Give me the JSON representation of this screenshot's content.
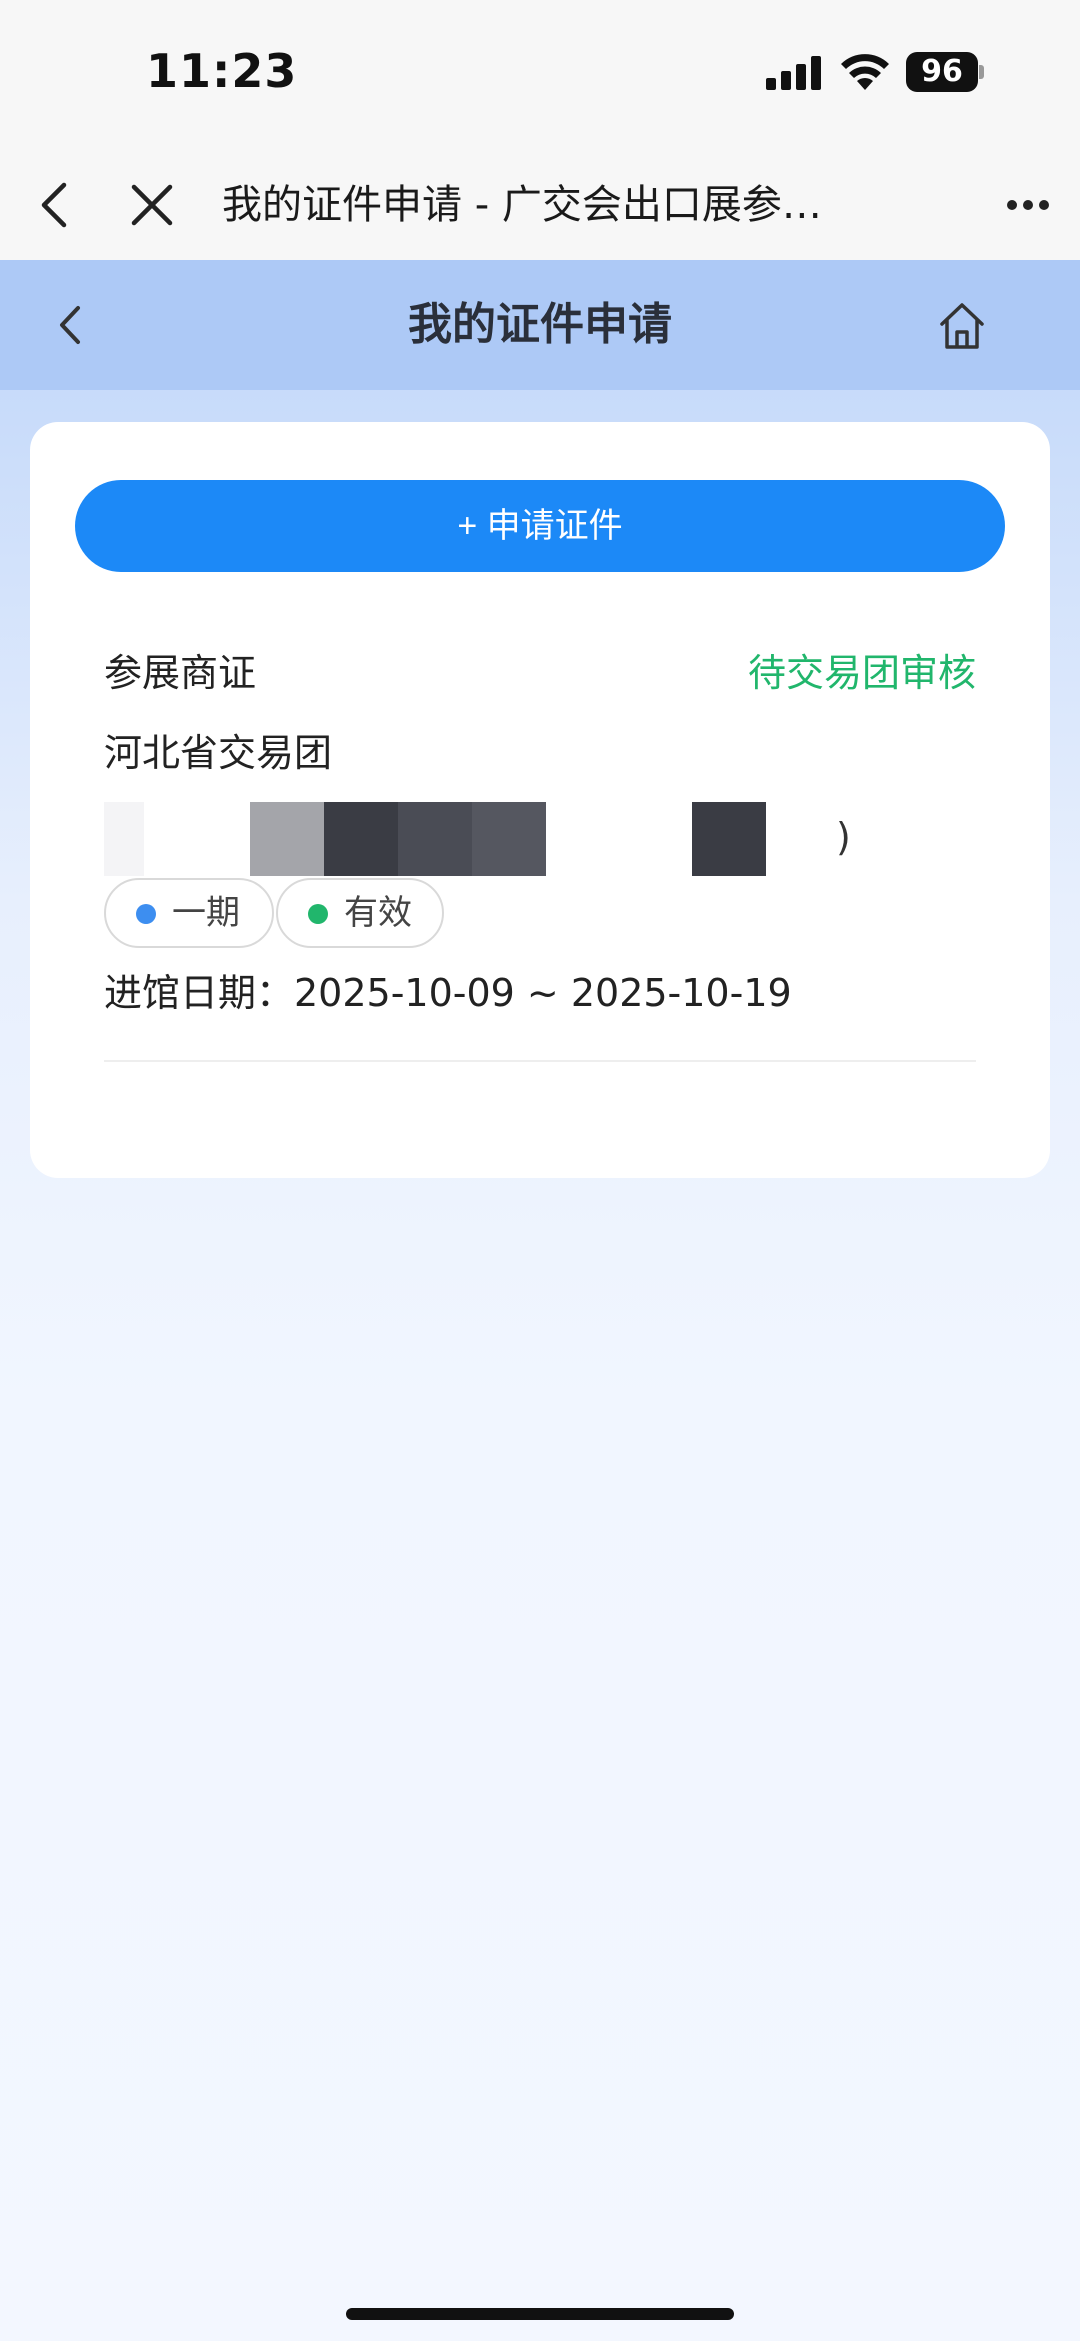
{
  "status_bar": {
    "time": "11:23",
    "battery": "96",
    "icons": [
      "signal-icon",
      "wifi-icon",
      "battery-icon"
    ]
  },
  "browser": {
    "title": "我的证件申请 - 广交会出口展参…",
    "icons": [
      "chevron-left-icon",
      "close-icon",
      "more-icon"
    ]
  },
  "header": {
    "title": "我的证件申请",
    "icons": [
      "chevron-left-icon",
      "home-icon"
    ]
  },
  "card": {
    "apply_label": "+ 申请证件",
    "cert_type": "参展商证",
    "status": "待交易团审核",
    "delegation": "河北省交易团",
    "redacted_tail": ")",
    "tags": [
      {
        "label": "一期",
        "dot_color": "#3d8ef0"
      },
      {
        "label": "有效",
        "dot_color": "#21b66c"
      }
    ],
    "entry_date": "进馆日期：2025-10-09 ~ 2025-10-19"
  },
  "colors": {
    "accent": "#1c89f7",
    "status_pending": "#21b66c",
    "header_bg": "#adc9f6"
  }
}
